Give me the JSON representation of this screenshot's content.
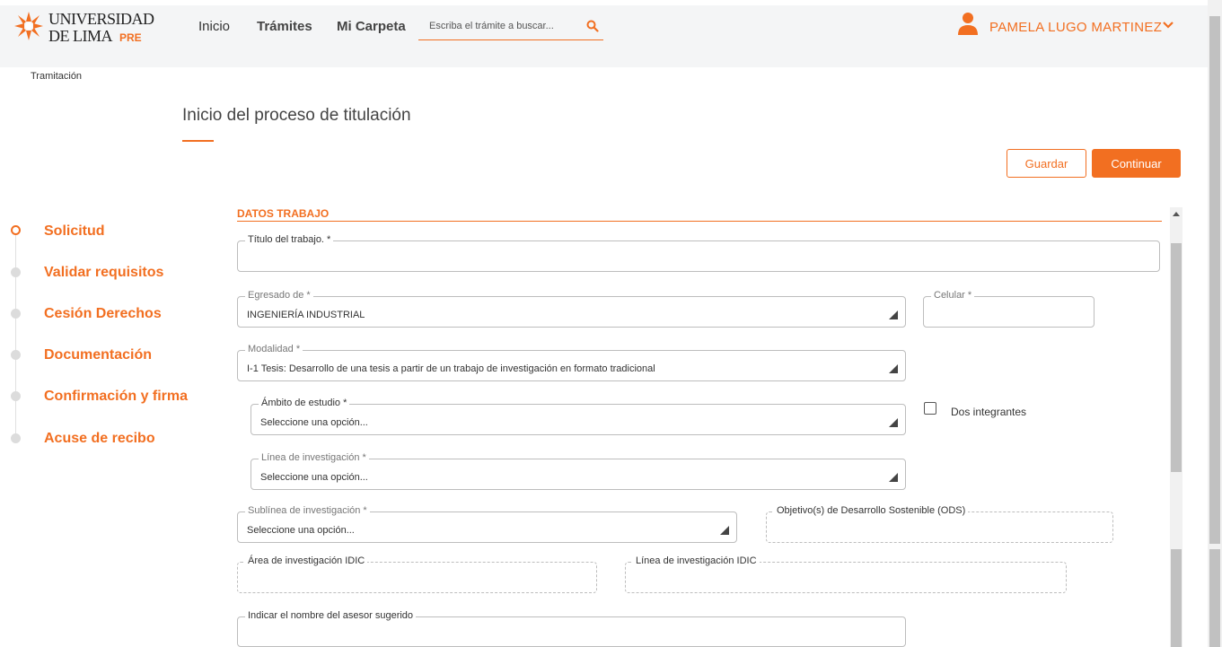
{
  "header": {
    "logo": {
      "line1": "UNIVERSIDAD",
      "line2": "DE LIMA",
      "badge": "PRE"
    },
    "nav": {
      "inicio": "Inicio",
      "tramites": "Trámites",
      "mi_carpeta": "Mi Carpeta"
    },
    "search": {
      "placeholder": "Escriba el trámite a buscar..."
    },
    "user": {
      "name": "PAMELA LUGO MARTINEZ"
    }
  },
  "breadcrumb": "Tramitación",
  "page": {
    "title": "Inicio del proceso de titulación",
    "buttons": {
      "guardar": "Guardar",
      "continuar": "Continuar"
    }
  },
  "steps": [
    {
      "label": "Solicitud"
    },
    {
      "label": "Validar requisitos"
    },
    {
      "label": "Cesión Derechos"
    },
    {
      "label": "Documentación"
    },
    {
      "label": "Confirmación y firma"
    },
    {
      "label": "Acuse de recibo"
    }
  ],
  "form": {
    "section_title": "DATOS TRABAJO",
    "titulo": {
      "label": "Título del trabajo. *",
      "value": ""
    },
    "egresado": {
      "label": "Egresado de *",
      "value": "INGENIERÍA INDUSTRIAL"
    },
    "celular": {
      "label": "Celular *",
      "value": ""
    },
    "modalidad": {
      "label": "Modalidad *",
      "value": "I-1 Tesis: Desarrollo de una tesis a partir de un trabajo de investigación en formato tradicional"
    },
    "ambito": {
      "label": "Ámbito de estudio *",
      "value": "Seleccione una opción..."
    },
    "dos_integrantes": {
      "label": "Dos integrantes"
    },
    "linea": {
      "label": "Línea de investigación *",
      "value": "Seleccione una opción..."
    },
    "sublinea": {
      "label": "Sublínea de investigación *",
      "value": "Seleccione una opción..."
    },
    "ods": {
      "label": "Objetivo(s) de Desarrollo Sostenible (ODS)",
      "value": ""
    },
    "area_idic": {
      "label": "Área de investigación IDIC",
      "value": ""
    },
    "linea_idic": {
      "label": "Línea de investigación IDIC",
      "value": ""
    },
    "asesor": {
      "label": "Indicar el nombre del asesor sugerido",
      "value": ""
    }
  },
  "colors": {
    "accent": "#f26f21",
    "header_bg": "#f4f5f6"
  }
}
